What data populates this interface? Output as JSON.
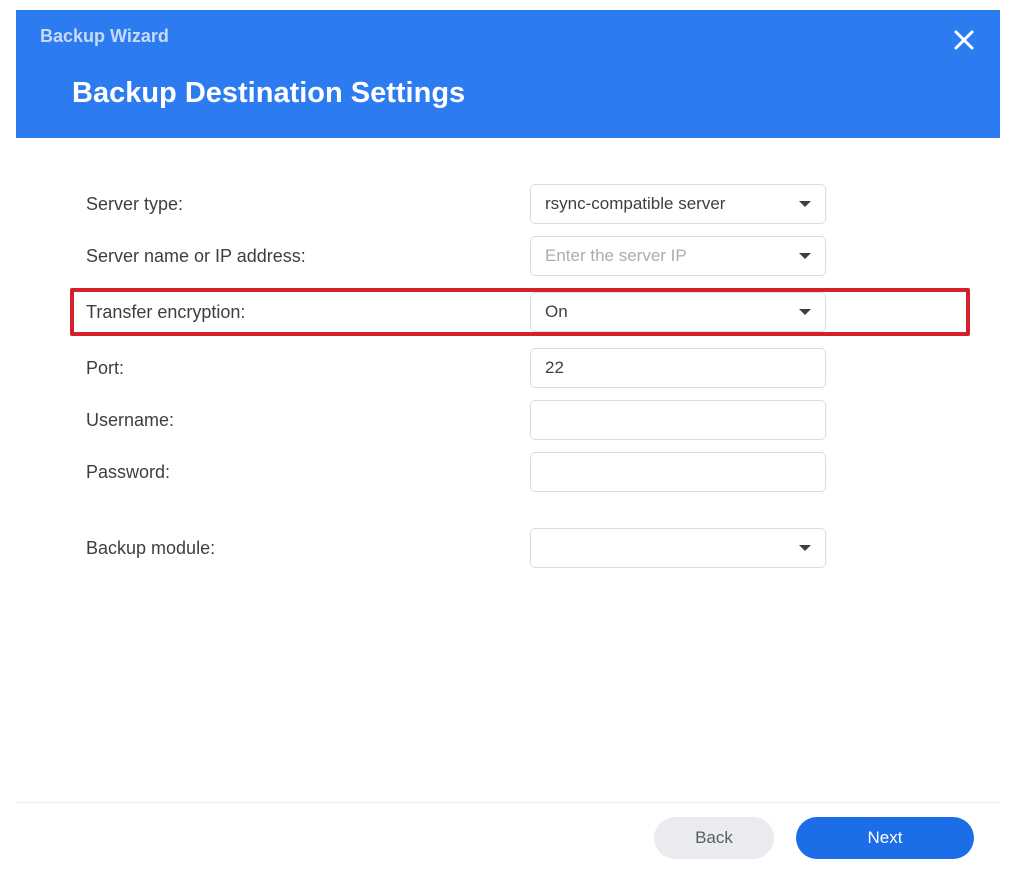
{
  "header": {
    "title": "Backup Wizard",
    "subtitle": "Backup Destination Settings"
  },
  "fields": {
    "server_type": {
      "label": "Server type:",
      "value": "rsync-compatible server"
    },
    "server_ip": {
      "label": "Server name or IP address:",
      "placeholder": "Enter the server IP",
      "value": ""
    },
    "transfer_encryption": {
      "label": "Transfer encryption:",
      "value": "On"
    },
    "port": {
      "label": "Port:",
      "value": "22"
    },
    "username": {
      "label": "Username:",
      "value": ""
    },
    "password": {
      "label": "Password:",
      "value": ""
    },
    "backup_module": {
      "label": "Backup module:",
      "value": ""
    }
  },
  "buttons": {
    "back": "Back",
    "next": "Next"
  }
}
